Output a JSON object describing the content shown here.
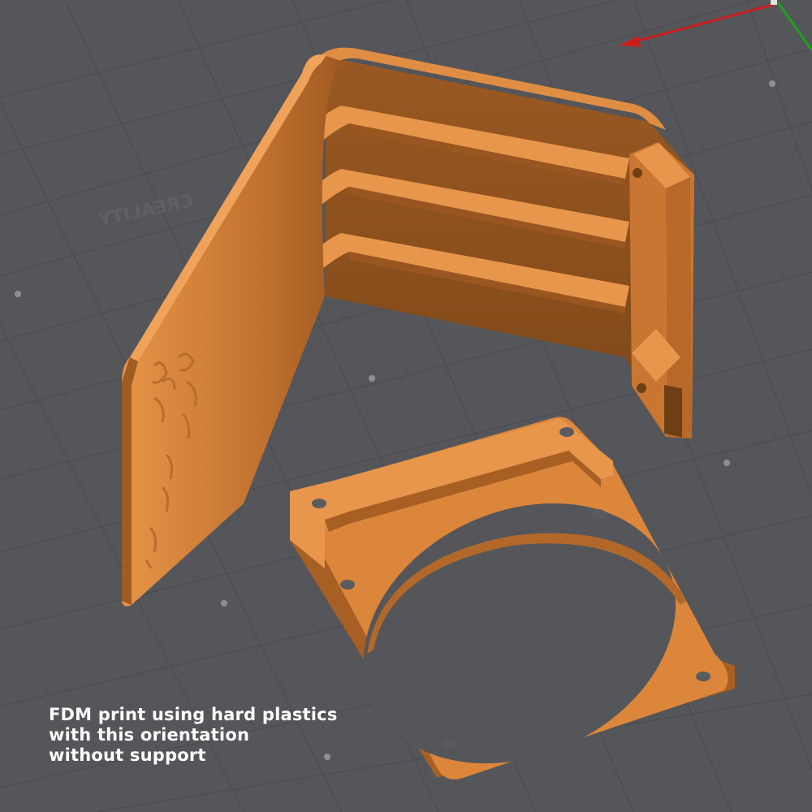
{
  "viewport": {
    "background": "#555659",
    "grid_color": "#4a4b4f",
    "part_color": "#d9853a",
    "part_shadow_color": "#a8622a",
    "axis_x_color": "#c81e1e",
    "axis_y_color": "#1fa01f",
    "bed_logo_text": "CREALITY"
  },
  "caption": {
    "line1": "FDM print using hard plastics",
    "line2": "with this orientation",
    "line3": "without support"
  }
}
